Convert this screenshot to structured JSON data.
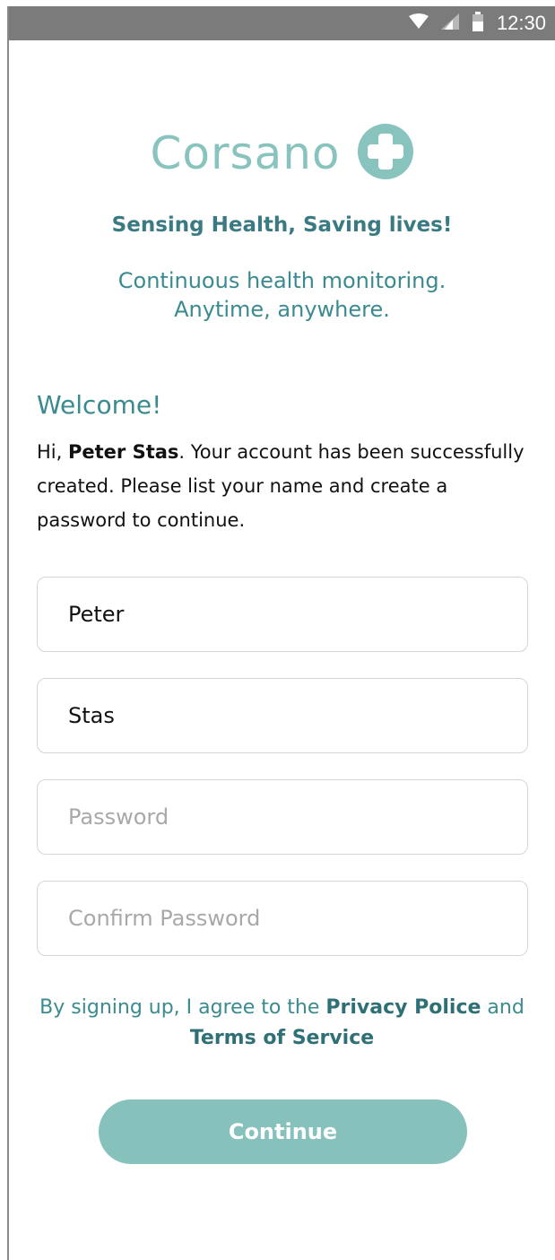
{
  "status_bar": {
    "time": "12:30",
    "icons": [
      "wifi-icon",
      "signal-icon",
      "battery-icon"
    ],
    "background": "#7b7b7b"
  },
  "logo": {
    "text": "Corsano",
    "icon": "plus-cross-icon",
    "color": "#88c3be"
  },
  "tagline": "Sensing Health, Saving lives!",
  "subtagline": {
    "line1": "Continuous health monitoring.",
    "line2": "Anytime, anywhere."
  },
  "welcome": {
    "title": "Welcome!",
    "greeting": "Hi, ",
    "name": "Peter Stas",
    "message": ". Your account has been successfully created. Please list your name and create a password to continue."
  },
  "form": {
    "first_name": {
      "value": "Peter",
      "placeholder": ""
    },
    "last_name": {
      "value": "Stas",
      "placeholder": ""
    },
    "password": {
      "value": "",
      "placeholder": "Password"
    },
    "confirm_password": {
      "value": "",
      "placeholder": "Confirm Password"
    }
  },
  "agreement": {
    "prefix": "By signing up, I agree to the ",
    "privacy_link": "Privacy Police",
    "middle": " and",
    "terms_link": "Terms of Service"
  },
  "continue_button": {
    "label": "Continue",
    "color": "#87c1bc"
  },
  "colors": {
    "primary_teal": "#3a8a90",
    "dark_teal": "#2f6f76",
    "light_teal": "#88c3be"
  }
}
